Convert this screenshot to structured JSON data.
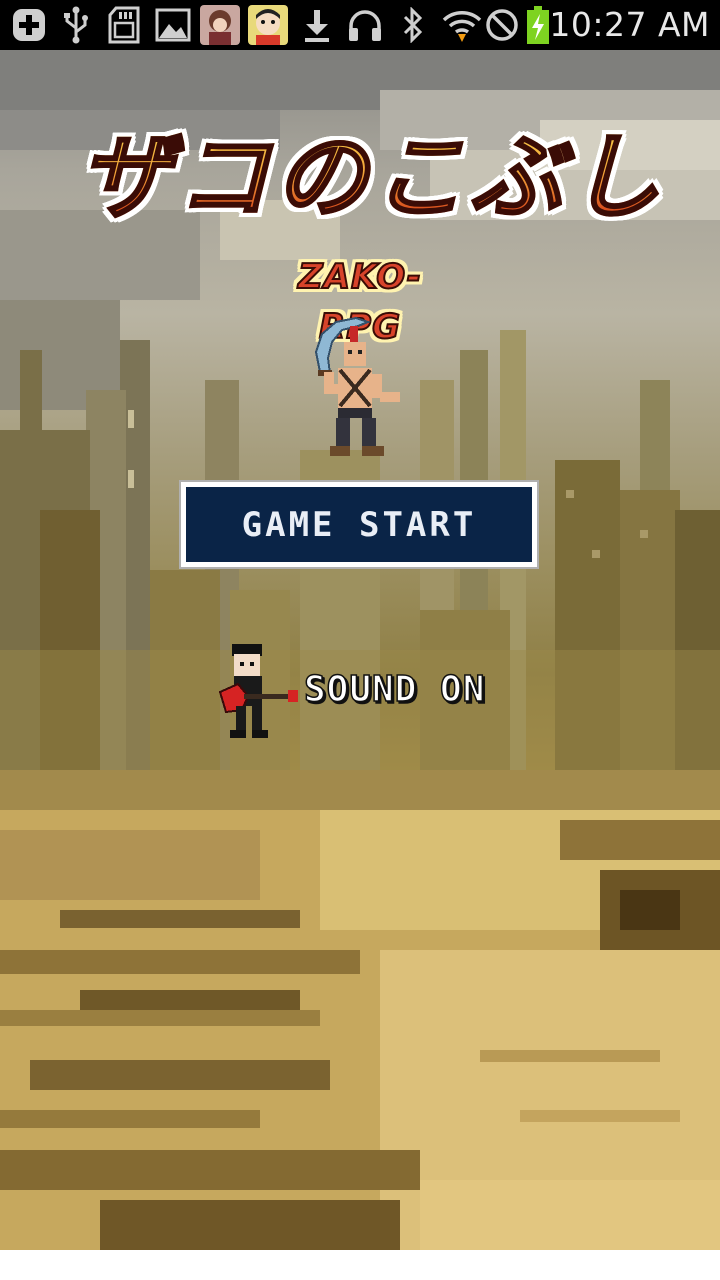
{
  "status_bar": {
    "time": "10:27 AM",
    "left_icons": [
      "add-notification-icon",
      "usb-icon",
      "sd-card-icon",
      "gallery-icon",
      "app-avatar-1-icon",
      "app-avatar-2-icon",
      "download-icon"
    ],
    "right_icons": [
      "headphones-icon",
      "bluetooth-icon",
      "wifi-icon",
      "do-not-disturb-icon",
      "battery-charging-icon"
    ],
    "battery_color": "#7ed321"
  },
  "game": {
    "title": "ザコのこぶし",
    "subtitle": "ZAKO-RPG",
    "start_button_label": "GAME START",
    "sound_label": "SOUND ON",
    "colors": {
      "button_bg": "#0a2447",
      "title_orange": "#f3a63a",
      "title_red": "#d9531f",
      "ground_sand": "#c9ac5f"
    }
  }
}
